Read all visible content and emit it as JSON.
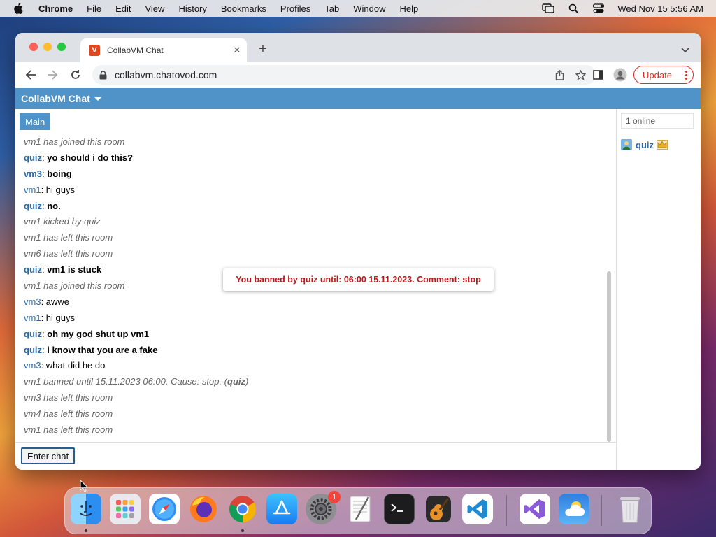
{
  "menubar": {
    "app": "Chrome",
    "items": [
      "File",
      "Edit",
      "View",
      "History",
      "Bookmarks",
      "Profiles",
      "Tab",
      "Window",
      "Help"
    ],
    "clock": "Wed Nov 15  5:56 AM"
  },
  "browser": {
    "tab_title": "CollabVM Chat",
    "url": "collabvm.chatovod.com",
    "update_label": "Update"
  },
  "app": {
    "title": "CollabVM Chat",
    "room_tab": "Main",
    "online": "1 online",
    "users": [
      {
        "name": "quiz"
      }
    ],
    "enter_chat": "Enter chat",
    "toast": "You banned by quiz until: 06:00 15.11.2023. Comment: stop"
  },
  "messages": [
    {
      "type": "sys",
      "text": "vm1 has joined this room"
    },
    {
      "type": "msg",
      "user": "quiz",
      "text": "yo should i do this?",
      "bold": true
    },
    {
      "type": "msg",
      "user": "vm3",
      "text": "boing",
      "bold": true
    },
    {
      "type": "msg",
      "user": "vm1",
      "text": "hi guys",
      "bold": false
    },
    {
      "type": "msg",
      "user": "quiz",
      "text": "no.",
      "bold": true
    },
    {
      "type": "sys",
      "text": "vm1 kicked by quiz"
    },
    {
      "type": "sys",
      "text": "vm1 has left this room"
    },
    {
      "type": "sys",
      "text": "vm6 has left this room"
    },
    {
      "type": "msg",
      "user": "quiz",
      "text": "vm1 is stuck",
      "bold": true
    },
    {
      "type": "sys",
      "text": "vm1 has joined this room"
    },
    {
      "type": "msg",
      "user": "vm3",
      "text": "awwe",
      "bold": false
    },
    {
      "type": "msg",
      "user": "vm1",
      "text": "hi guys",
      "bold": false
    },
    {
      "type": "msg",
      "user": "quiz",
      "text": "oh my god shut up vm1",
      "bold": true
    },
    {
      "type": "msg",
      "user": "quiz",
      "text": "i know that you are a fake",
      "bold": true
    },
    {
      "type": "msg",
      "user": "vm3",
      "text": "what did he do",
      "bold": false
    },
    {
      "type": "sys",
      "text": "vm1 banned until 15.11.2023 06:00. Cause: stop. (",
      "bold_tail": "quiz",
      "after": ")"
    },
    {
      "type": "sys",
      "text": "vm3 has left this room"
    },
    {
      "type": "sys",
      "text": "vm4 has left this room"
    },
    {
      "type": "sys",
      "text": "vm1 has left this room"
    }
  ],
  "dock": {
    "apps": [
      {
        "name": "Finder",
        "icon": "finder-icon"
      },
      {
        "name": "Launchpad",
        "icon": "launchpad-icon"
      },
      {
        "name": "Safari",
        "icon": "safari-icon"
      },
      {
        "name": "Firefox",
        "icon": "firefox-icon"
      },
      {
        "name": "Chrome",
        "icon": "chrome-icon"
      },
      {
        "name": "App Store",
        "icon": "app-store-icon"
      },
      {
        "name": "System Settings",
        "icon": "settings-icon"
      },
      {
        "name": "TextEdit",
        "icon": "textedit-icon"
      },
      {
        "name": "Terminal",
        "icon": "terminal-icon"
      },
      {
        "name": "GarageBand",
        "icon": "garageband-icon"
      },
      {
        "name": "Visual Studio Code",
        "icon": "vscode-icon"
      },
      {
        "name": "Visual Studio",
        "icon": "visual-studio-icon"
      },
      {
        "name": "Weather",
        "icon": "weather-icon"
      },
      {
        "name": "Trash",
        "icon": "trash-icon"
      }
    ],
    "settings_badge": "1"
  },
  "colors": {
    "accent": "#4f93c9",
    "username": "#2a6aa8",
    "error": "#c0171b",
    "update": "#d93025"
  }
}
